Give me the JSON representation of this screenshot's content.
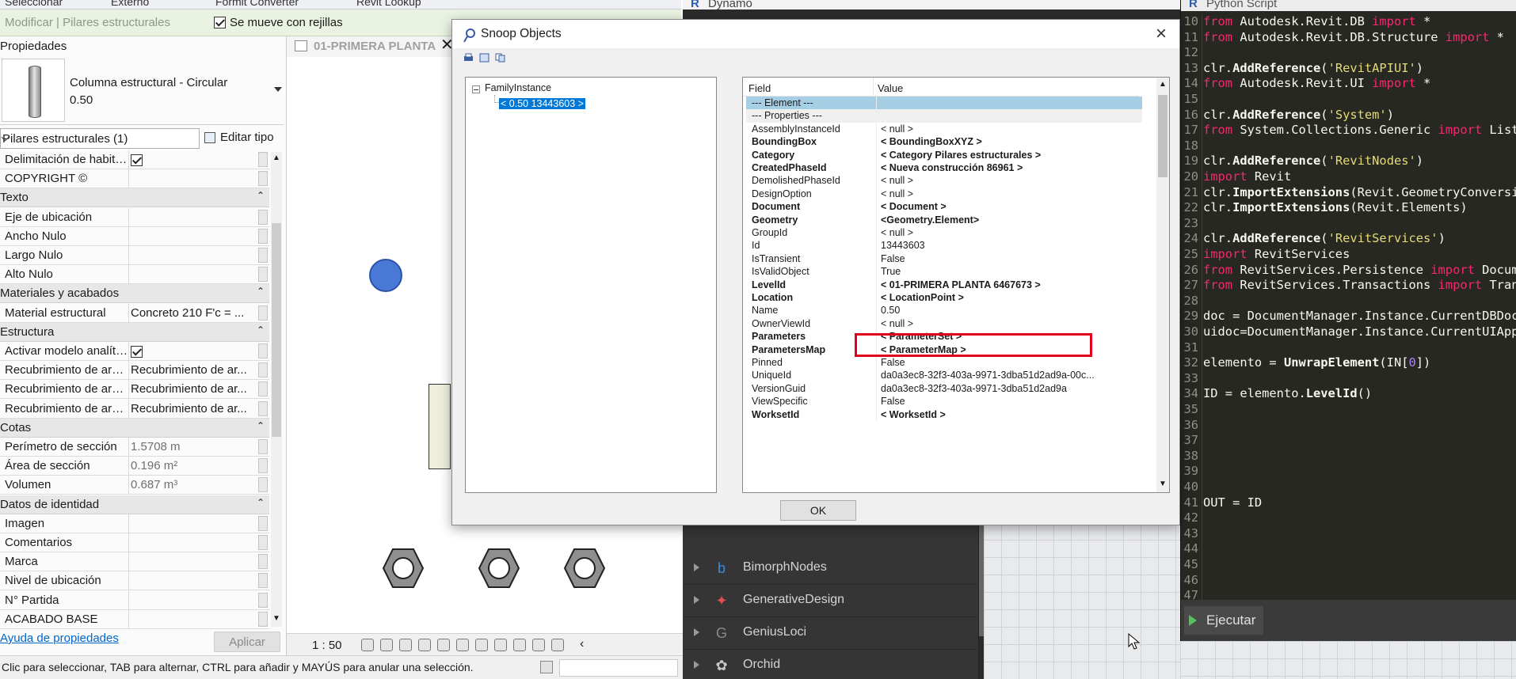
{
  "revit": {
    "top_menu": [
      "Seleccionar",
      "Externo",
      "Formit Converter",
      "Revit Lookup"
    ],
    "context_label": "Modificar | Pilares estructurales",
    "move_with_grids_label": "Se mueve con rejillas",
    "properties": {
      "title": "Propiedades",
      "type_name": "Columna estructural - Circular",
      "type_size": "0.50",
      "filter_label": "Pilares estructurales (1)",
      "edit_type_label": "Editar tipo",
      "rows": [
        {
          "kind": "row",
          "label": "Delimitación de habit…",
          "value": "",
          "checkbox": true
        },
        {
          "kind": "row",
          "label": "COPYRIGHT ©",
          "value": ""
        },
        {
          "kind": "group",
          "label": "Texto"
        },
        {
          "kind": "row",
          "label": "Eje de ubicación",
          "value": ""
        },
        {
          "kind": "row",
          "label": "Ancho Nulo",
          "value": ""
        },
        {
          "kind": "row",
          "label": "Largo Nulo",
          "value": ""
        },
        {
          "kind": "row",
          "label": "Alto Nulo",
          "value": ""
        },
        {
          "kind": "group",
          "label": "Materiales y acabados"
        },
        {
          "kind": "row",
          "label": "Material estructural",
          "value": "Concreto 210 F'c = ..."
        },
        {
          "kind": "group",
          "label": "Estructura"
        },
        {
          "kind": "row",
          "label": "Activar modelo analít…",
          "value": "",
          "checkbox": true
        },
        {
          "kind": "row",
          "label": "Recubrimiento de ar…",
          "value": "Recubrimiento de ar..."
        },
        {
          "kind": "row",
          "label": "Recubrimiento de ar…",
          "value": "Recubrimiento de ar..."
        },
        {
          "kind": "row",
          "label": "Recubrimiento de ar…",
          "value": "Recubrimiento de ar..."
        },
        {
          "kind": "group",
          "label": "Cotas"
        },
        {
          "kind": "row",
          "label": "Perímetro de sección",
          "value": "1.5708 m",
          "readonly": true
        },
        {
          "kind": "row",
          "label": "Área de sección",
          "value": "0.196 m²",
          "readonly": true
        },
        {
          "kind": "row",
          "label": "Volumen",
          "value": "0.687 m³",
          "readonly": true
        },
        {
          "kind": "group",
          "label": "Datos de identidad"
        },
        {
          "kind": "row",
          "label": "Imagen",
          "value": ""
        },
        {
          "kind": "row",
          "label": "Comentarios",
          "value": ""
        },
        {
          "kind": "row",
          "label": "Marca",
          "value": ""
        },
        {
          "kind": "row",
          "label": "Nivel de ubicación",
          "value": ""
        },
        {
          "kind": "row",
          "label": "N° Partida",
          "value": ""
        },
        {
          "kind": "row",
          "label": "ACABADO BASE",
          "value": ""
        }
      ],
      "help_link": "Ayuda de propiedades",
      "apply_label": "Aplicar"
    },
    "view_tab_title": "01-PRIMERA PLANTA",
    "view_scale": "1 : 50",
    "status_text": "Clic para seleccionar, TAB para alternar, CTRL para añadir y MAYÚS para anular una selección."
  },
  "dynamo": {
    "title": "Dynamo",
    "library": [
      {
        "name": "BimorphNodes",
        "icon": "b",
        "color": "#3d8bd8"
      },
      {
        "name": "GenerativeDesign",
        "icon": "✦",
        "color": "#e05050"
      },
      {
        "name": "GeniusLoci",
        "icon": "G",
        "color": "#8a8a8a"
      },
      {
        "name": "Orchid",
        "icon": "✿",
        "color": "#c8c8c8"
      }
    ]
  },
  "python": {
    "title": "Python Script",
    "run_label": "Ejecutar",
    "lines": [
      {
        "n": "10",
        "segs": [
          [
            "kw",
            "from"
          ],
          [
            "c",
            " Autodesk.Revit.DB "
          ],
          [
            "kw",
            "import"
          ],
          [
            "c",
            " *"
          ]
        ]
      },
      {
        "n": "11",
        "segs": [
          [
            "kw",
            "from"
          ],
          [
            "c",
            " Autodesk.Revit.DB.Structure "
          ],
          [
            "kw",
            "import"
          ],
          [
            "c",
            " *"
          ]
        ]
      },
      {
        "n": "12",
        "segs": []
      },
      {
        "n": "13",
        "segs": [
          [
            "c",
            "clr."
          ],
          [
            "fn",
            "AddReference"
          ],
          [
            "c",
            "("
          ],
          [
            "st",
            "'RevitAPIUI'"
          ],
          [
            "c",
            ")"
          ]
        ]
      },
      {
        "n": "14",
        "segs": [
          [
            "kw",
            "from"
          ],
          [
            "c",
            " Autodesk.Revit.UI "
          ],
          [
            "kw",
            "import"
          ],
          [
            "c",
            " *"
          ]
        ]
      },
      {
        "n": "15",
        "segs": []
      },
      {
        "n": "16",
        "segs": [
          [
            "c",
            "clr."
          ],
          [
            "fn",
            "AddReference"
          ],
          [
            "c",
            "("
          ],
          [
            "st",
            "'System'"
          ],
          [
            "c",
            ")"
          ]
        ]
      },
      {
        "n": "17",
        "segs": [
          [
            "kw",
            "from"
          ],
          [
            "c",
            " System.Collections.Generic "
          ],
          [
            "kw",
            "import"
          ],
          [
            "c",
            " List"
          ]
        ]
      },
      {
        "n": "18",
        "segs": []
      },
      {
        "n": "19",
        "segs": [
          [
            "c",
            "clr."
          ],
          [
            "fn",
            "AddReference"
          ],
          [
            "c",
            "("
          ],
          [
            "st",
            "'RevitNodes'"
          ],
          [
            "c",
            ")"
          ]
        ]
      },
      {
        "n": "20",
        "segs": [
          [
            "kw",
            "import"
          ],
          [
            "c",
            " Revit"
          ]
        ]
      },
      {
        "n": "21",
        "segs": [
          [
            "c",
            "clr."
          ],
          [
            "fn",
            "ImportExtensions"
          ],
          [
            "c",
            "(Revit.GeometryConversio"
          ]
        ]
      },
      {
        "n": "22",
        "segs": [
          [
            "c",
            "clr."
          ],
          [
            "fn",
            "ImportExtensions"
          ],
          [
            "c",
            "(Revit.Elements)"
          ]
        ]
      },
      {
        "n": "23",
        "segs": []
      },
      {
        "n": "24",
        "segs": [
          [
            "c",
            "clr."
          ],
          [
            "fn",
            "AddReference"
          ],
          [
            "c",
            "("
          ],
          [
            "st",
            "'RevitServices'"
          ],
          [
            "c",
            ")"
          ]
        ]
      },
      {
        "n": "25",
        "segs": [
          [
            "kw",
            "import"
          ],
          [
            "c",
            " RevitServices"
          ]
        ]
      },
      {
        "n": "26",
        "segs": [
          [
            "kw",
            "from"
          ],
          [
            "c",
            " RevitServices.Persistence "
          ],
          [
            "kw",
            "import"
          ],
          [
            "c",
            " Docume"
          ]
        ]
      },
      {
        "n": "27",
        "segs": [
          [
            "kw",
            "from"
          ],
          [
            "c",
            " RevitServices.Transactions "
          ],
          [
            "kw",
            "import"
          ],
          [
            "c",
            " Trans"
          ]
        ]
      },
      {
        "n": "28",
        "segs": []
      },
      {
        "n": "29",
        "segs": [
          [
            "c",
            "doc = DocumentManager.Instance.CurrentDBDocu"
          ]
        ]
      },
      {
        "n": "30",
        "segs": [
          [
            "c",
            "uidoc=DocumentManager.Instance.CurrentUIAppl"
          ]
        ]
      },
      {
        "n": "31",
        "segs": []
      },
      {
        "n": "32",
        "segs": [
          [
            "c",
            "elemento = "
          ],
          [
            "fn",
            "UnwrapElement"
          ],
          [
            "c",
            "(IN["
          ],
          [
            "nu",
            "0"
          ],
          [
            "c",
            "])"
          ]
        ]
      },
      {
        "n": "33",
        "segs": []
      },
      {
        "n": "34",
        "segs": [
          [
            "c",
            "ID = elemento."
          ],
          [
            "fn",
            "LevelId"
          ],
          [
            "c",
            "()"
          ]
        ]
      },
      {
        "n": "35",
        "segs": []
      },
      {
        "n": "36",
        "segs": []
      },
      {
        "n": "37",
        "segs": []
      },
      {
        "n": "38",
        "segs": []
      },
      {
        "n": "39",
        "segs": []
      },
      {
        "n": "40",
        "segs": []
      },
      {
        "n": "41",
        "segs": [
          [
            "c",
            "OUT = ID"
          ]
        ]
      },
      {
        "n": "42",
        "segs": []
      },
      {
        "n": "43",
        "segs": []
      },
      {
        "n": "44",
        "segs": []
      },
      {
        "n": "45",
        "segs": []
      },
      {
        "n": "46",
        "segs": []
      },
      {
        "n": "47",
        "segs": []
      }
    ]
  },
  "snoop": {
    "title": "Snoop Objects",
    "tree_root": "FamilyInstance",
    "tree_child": "< 0.50  13443603 >",
    "col_field": "Field",
    "col_value": "Value",
    "rows": [
      {
        "f": "--- Element ---",
        "v": "",
        "style": "section"
      },
      {
        "f": "--- Properties ---",
        "v": "",
        "style": "sub"
      },
      {
        "f": "AssemblyInstanceId",
        "v": "< null >"
      },
      {
        "f": "BoundingBox",
        "v": "< BoundingBoxXYZ >",
        "bold": true
      },
      {
        "f": "Category",
        "v": "< Category  Pilares estructurales >",
        "bold": true
      },
      {
        "f": "CreatedPhaseId",
        "v": "< Nueva construcción  86961 >",
        "bold": true
      },
      {
        "f": "DemolishedPhaseId",
        "v": "< null >"
      },
      {
        "f": "DesignOption",
        "v": "< null >"
      },
      {
        "f": "Document",
        "v": "< Document >",
        "bold": true
      },
      {
        "f": "Geometry",
        "v": "<Geometry.Element>",
        "bold": true
      },
      {
        "f": "GroupId",
        "v": "< null >"
      },
      {
        "f": "Id",
        "v": "13443603"
      },
      {
        "f": "IsTransient",
        "v": "False"
      },
      {
        "f": "IsValidObject",
        "v": "True"
      },
      {
        "f": "LevelId",
        "v": "< 01-PRIMERA PLANTA  6467673 >",
        "bold": true
      },
      {
        "f": "Location",
        "v": "< LocationPoint >",
        "bold": true
      },
      {
        "f": "Name",
        "v": "0.50"
      },
      {
        "f": "OwnerViewId",
        "v": "< null >"
      },
      {
        "f": "Parameters",
        "v": "< ParameterSet >",
        "bold": true
      },
      {
        "f": "ParametersMap",
        "v": "< ParameterMap >",
        "bold": true
      },
      {
        "f": "Pinned",
        "v": "False"
      },
      {
        "f": "UniqueId",
        "v": "da0a3ec8-32f3-403a-9971-3dba51d2ad9a-00c..."
      },
      {
        "f": "VersionGuid",
        "v": "da0a3ec8-32f3-403a-9971-3dba51d2ad9a"
      },
      {
        "f": "ViewSpecific",
        "v": "False"
      },
      {
        "f": "WorksetId",
        "v": "< WorksetId >",
        "bold": true
      }
    ],
    "ok_label": "OK",
    "highlight_color": "#e3001b"
  }
}
